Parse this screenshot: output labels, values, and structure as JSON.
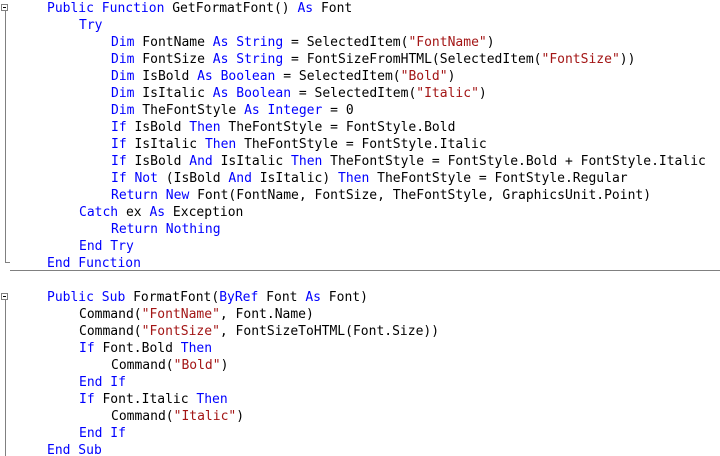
{
  "colors": {
    "keyword": "#0000ff",
    "string": "#a31515",
    "identifier": "#000000",
    "gutter": "#808080",
    "background": "#ffffff"
  },
  "lines": [
    {
      "tokens": [
        [
          "kw",
          "Public Function"
        ],
        [
          "id",
          " GetFormatFont() "
        ],
        [
          "kw",
          "As"
        ],
        [
          "id",
          " Font"
        ]
      ]
    },
    {
      "tokens": [
        [
          "kw",
          "Try"
        ]
      ]
    },
    {
      "tokens": [
        [
          "kw",
          "Dim"
        ],
        [
          "id",
          " FontName "
        ],
        [
          "kw",
          "As String"
        ],
        [
          "id",
          " = SelectedItem("
        ],
        [
          "str",
          "\"FontName\""
        ],
        [
          "id",
          ")"
        ]
      ]
    },
    {
      "tokens": [
        [
          "kw",
          "Dim"
        ],
        [
          "id",
          " FontSize "
        ],
        [
          "kw",
          "As String"
        ],
        [
          "id",
          " = FontSizeFromHTML(SelectedItem("
        ],
        [
          "str",
          "\"FontSize\""
        ],
        [
          "id",
          "))"
        ]
      ]
    },
    {
      "tokens": [
        [
          "kw",
          "Dim"
        ],
        [
          "id",
          " IsBold "
        ],
        [
          "kw",
          "As Boolean"
        ],
        [
          "id",
          " = SelectedItem("
        ],
        [
          "str",
          "\"Bold\""
        ],
        [
          "id",
          ")"
        ]
      ]
    },
    {
      "tokens": [
        [
          "kw",
          "Dim"
        ],
        [
          "id",
          " IsItalic "
        ],
        [
          "kw",
          "As Boolean"
        ],
        [
          "id",
          " = SelectedItem("
        ],
        [
          "str",
          "\"Italic\""
        ],
        [
          "id",
          ")"
        ]
      ]
    },
    {
      "tokens": [
        [
          "kw",
          "Dim"
        ],
        [
          "id",
          " TheFontStyle "
        ],
        [
          "kw",
          "As Integer"
        ],
        [
          "id",
          " = 0"
        ]
      ]
    },
    {
      "tokens": [
        [
          "kw",
          "If"
        ],
        [
          "id",
          " IsBold "
        ],
        [
          "kw",
          "Then"
        ],
        [
          "id",
          " TheFontStyle = FontStyle.Bold"
        ]
      ]
    },
    {
      "tokens": [
        [
          "kw",
          "If"
        ],
        [
          "id",
          " IsItalic "
        ],
        [
          "kw",
          "Then"
        ],
        [
          "id",
          " TheFontStyle = FontStyle.Italic"
        ]
      ]
    },
    {
      "tokens": [
        [
          "kw",
          "If"
        ],
        [
          "id",
          " IsBold "
        ],
        [
          "kw",
          "And"
        ],
        [
          "id",
          " IsItalic "
        ],
        [
          "kw",
          "Then"
        ],
        [
          "id",
          " TheFontStyle = FontStyle.Bold + FontStyle.Italic"
        ]
      ]
    },
    {
      "tokens": [
        [
          "kw",
          "If Not"
        ],
        [
          "id",
          " (IsBold "
        ],
        [
          "kw",
          "And"
        ],
        [
          "id",
          " IsItalic) "
        ],
        [
          "kw",
          "Then"
        ],
        [
          "id",
          " TheFontStyle = FontStyle.Regular"
        ]
      ]
    },
    {
      "tokens": [
        [
          "kw",
          "Return New"
        ],
        [
          "id",
          " Font(FontName, FontSize, TheFontStyle, GraphicsUnit.Point)"
        ]
      ]
    },
    {
      "tokens": [
        [
          "kw",
          "Catch"
        ],
        [
          "id",
          " ex "
        ],
        [
          "kw",
          "As"
        ],
        [
          "id",
          " Exception"
        ]
      ]
    },
    {
      "tokens": [
        [
          "kw",
          "Return Nothing"
        ]
      ]
    },
    {
      "tokens": [
        [
          "kw",
          "End Try"
        ]
      ]
    },
    {
      "tokens": [
        [
          "kw",
          "End Function"
        ]
      ]
    },
    {
      "tokens": []
    },
    {
      "tokens": [
        [
          "kw",
          "Public Sub"
        ],
        [
          "id",
          " FormatFont("
        ],
        [
          "kw",
          "ByRef"
        ],
        [
          "id",
          " Font "
        ],
        [
          "kw",
          "As"
        ],
        [
          "id",
          " Font)"
        ]
      ]
    },
    {
      "tokens": [
        [
          "id",
          "Command("
        ],
        [
          "str",
          "\"FontName\""
        ],
        [
          "id",
          ", Font.Name)"
        ]
      ]
    },
    {
      "tokens": [
        [
          "id",
          "Command("
        ],
        [
          "str",
          "\"FontSize\""
        ],
        [
          "id",
          ", FontSizeToHTML(Font.Size))"
        ]
      ]
    },
    {
      "tokens": [
        [
          "kw",
          "If"
        ],
        [
          "id",
          " Font.Bold "
        ],
        [
          "kw",
          "Then"
        ]
      ]
    },
    {
      "tokens": [
        [
          "id",
          "Command("
        ],
        [
          "str",
          "\"Bold\""
        ],
        [
          "id",
          ")"
        ]
      ]
    },
    {
      "tokens": [
        [
          "kw",
          "End If"
        ]
      ]
    },
    {
      "tokens": [
        [
          "kw",
          "If"
        ],
        [
          "id",
          " Font.Italic "
        ],
        [
          "kw",
          "Then"
        ]
      ]
    },
    {
      "tokens": [
        [
          "id",
          "Command("
        ],
        [
          "str",
          "\"Italic\""
        ],
        [
          "id",
          ")"
        ]
      ]
    },
    {
      "tokens": [
        [
          "kw",
          "End If"
        ]
      ]
    },
    {
      "tokens": [
        [
          "kw",
          "End Sub"
        ]
      ]
    }
  ]
}
